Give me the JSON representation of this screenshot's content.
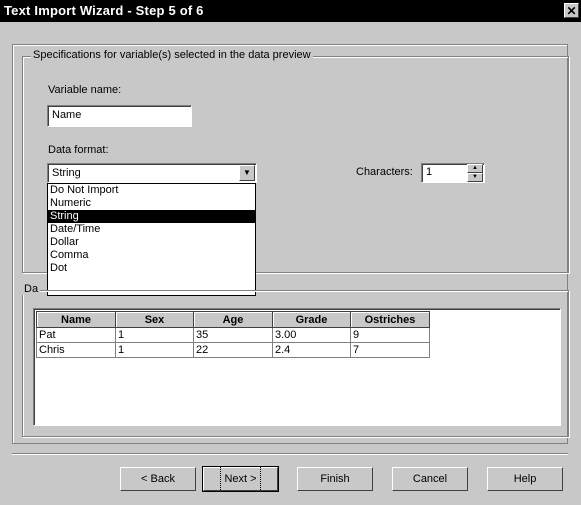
{
  "window": {
    "title": "Text Import Wizard - Step 5 of 6",
    "close_glyph": "✕"
  },
  "spec_group": {
    "legend": "Specifications for variable(s) selected in the data preview",
    "variable_name_label": "Variable name:",
    "variable_name_value": "Name",
    "data_format_label": "Data format:",
    "data_format_value": "String",
    "characters_label": "Characters:",
    "characters_value": "1",
    "format_options": [
      "Do Not Import",
      "Numeric",
      "String",
      "Date/Time",
      "Dollar",
      "Comma",
      "Dot"
    ],
    "selected_option_index": 2
  },
  "preview_group": {
    "legend_partial": "Da",
    "columns": [
      "Name",
      "Sex",
      "Age",
      "Grade",
      "Ostriches"
    ],
    "rows": [
      [
        "Pat",
        "1",
        "35",
        "3.00",
        "9"
      ],
      [
        "Chris",
        "1",
        "22",
        "2.4",
        "7"
      ]
    ]
  },
  "buttons": {
    "back": "< Back",
    "next": "Next >",
    "finish": "Finish",
    "cancel": "Cancel",
    "help": "Help"
  }
}
